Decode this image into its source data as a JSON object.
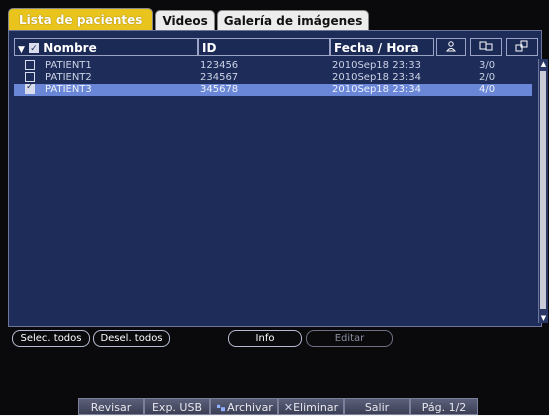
{
  "tabs": [
    {
      "label": "Lista de pacientes",
      "active": true
    },
    {
      "label": "Videos",
      "active": false
    },
    {
      "label": "Galería de imágenes",
      "active": false
    }
  ],
  "columns": {
    "name": "Nombre",
    "id": "ID",
    "date": "Fecha / Hora",
    "icons": [
      "person-icon",
      "image-icon",
      "gallery-icon"
    ]
  },
  "patients": [
    {
      "name": "PATIENT1",
      "id": "123456",
      "date": "2010Sep18  23:33",
      "count": "3/0",
      "checked": false,
      "selected": false
    },
    {
      "name": "PATIENT2",
      "id": "234567",
      "date": "2010Sep18  23:34",
      "count": "2/0",
      "checked": false,
      "selected": false
    },
    {
      "name": "PATIENT3",
      "id": "345678",
      "date": "2010Sep18  23:34",
      "count": "4/0",
      "checked": true,
      "selected": true
    }
  ],
  "buttons": {
    "select_all": "Selec. todos",
    "deselect_all": "Desel. todos",
    "info": "Info",
    "edit": "Editar"
  },
  "toolbar": {
    "review": "Revisar",
    "usb": "Exp. USB",
    "archive": "Archivar",
    "delete": "Eliminar",
    "exit": "Salir",
    "page": "Pág. 1/2"
  },
  "colors": {
    "accent_tab": "#e8c41c",
    "panel": "#1d2c58",
    "selected_row": "#6a86d6"
  }
}
